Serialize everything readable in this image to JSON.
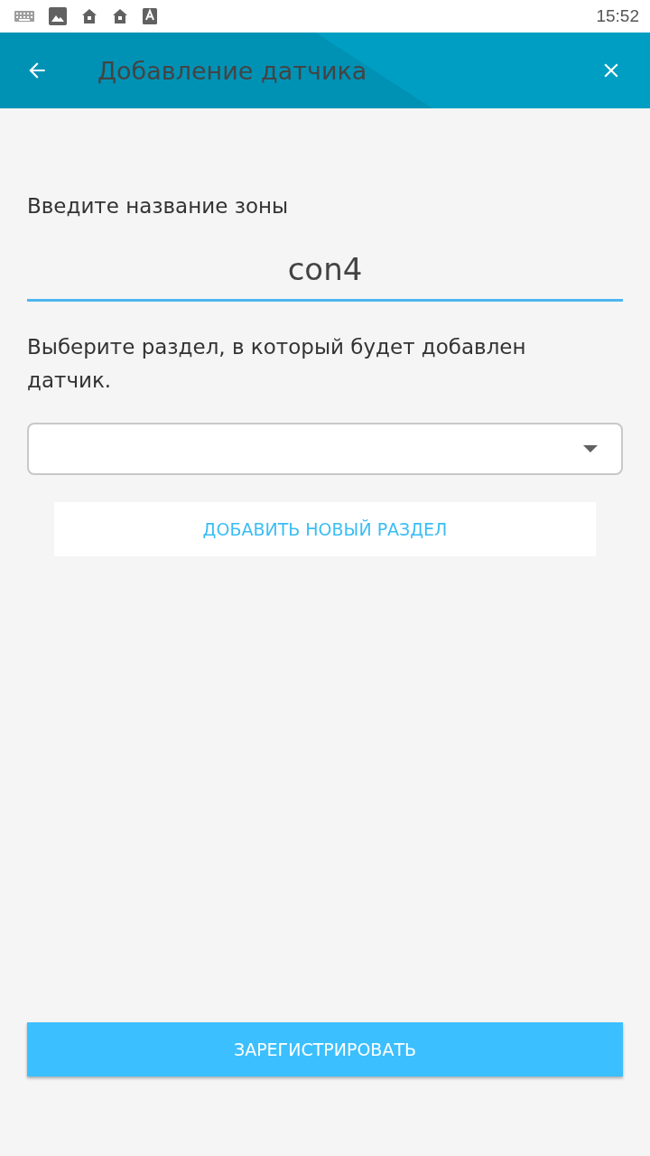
{
  "status_bar": {
    "time": "15:52"
  },
  "app_bar": {
    "title": "Добавление датчика"
  },
  "zone": {
    "label": "Введите название зоны",
    "value": "con4"
  },
  "section": {
    "label": "Выберите раздел, в который будет добавлен датчик."
  },
  "add_section_button": "ДОБАВИТЬ НОВЫЙ РАЗДЕЛ",
  "register_button": "ЗАРЕГИСТРИРОВАТЬ"
}
